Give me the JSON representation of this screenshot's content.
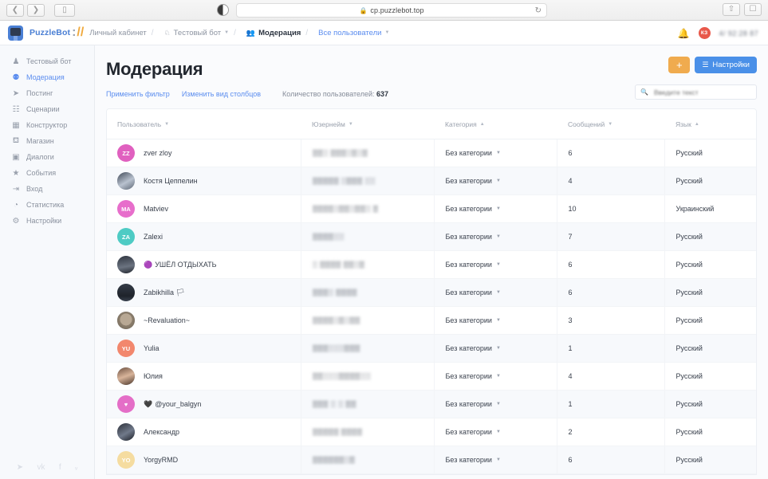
{
  "browser": {
    "back_icon": "chevron-left-icon",
    "forward_icon": "chevron-right-icon",
    "sidebar_toggle_icon": "sidebar-toggle-icon",
    "theme_toggle_icon": "theme-toggle-icon",
    "url": "cp.puzzlebot.top",
    "lock_icon": "lock-icon",
    "reload_icon": "reload-icon",
    "share_icon": "share-icon",
    "tabs_icon": "tabs-icon"
  },
  "header": {
    "logo_icon": "puzzlebot-logo-icon",
    "brand": "PuzzleBot",
    "brand_colon": ":",
    "brand_slash": "//",
    "crumbs": [
      {
        "label": "Личный кабинет",
        "icon": "",
        "caret": "",
        "style": "muted"
      },
      {
        "label": "Тестовый бот",
        "icon": "bot-icon",
        "caret": "▼",
        "style": "muted"
      },
      {
        "label": "Модерация",
        "icon": "users-icon",
        "caret": "",
        "style": "active"
      },
      {
        "label": "Все пользователи",
        "icon": "",
        "caret": "▼",
        "style": "link"
      }
    ],
    "separator": "/",
    "bell_icon": "bell-icon",
    "avatar_initials": "КЗ",
    "avatar_color": "#e8584a",
    "user_name": "4/ 92:28 87"
  },
  "sidebar": {
    "items": [
      {
        "label": "Тестовый бот",
        "icon": "bot-icon",
        "glyph": "♟",
        "active": false
      },
      {
        "label": "Модерация",
        "icon": "users-icon",
        "glyph": "⚉",
        "active": true
      },
      {
        "label": "Постинг",
        "icon": "send-icon",
        "glyph": "➤",
        "active": false
      },
      {
        "label": "Сценарии",
        "icon": "scenario-icon",
        "glyph": "☷",
        "active": false
      },
      {
        "label": "Конструктор",
        "icon": "grid-icon",
        "glyph": "▦",
        "active": false
      },
      {
        "label": "Магазин",
        "icon": "cart-icon",
        "glyph": "Ὥ2",
        "active": false
      },
      {
        "label": "Диалоги",
        "icon": "chat-icon",
        "glyph": "▣",
        "active": false
      },
      {
        "label": "События",
        "icon": "star-icon",
        "glyph": "★",
        "active": false
      },
      {
        "label": "Вход",
        "icon": "login-icon",
        "glyph": "⇥",
        "active": false
      },
      {
        "label": "Статистика",
        "icon": "chart-pie-icon",
        "glyph": "◔",
        "active": false
      },
      {
        "label": "Настройки",
        "icon": "gear-icon",
        "glyph": "⚙",
        "active": false
      }
    ],
    "social": [
      {
        "icon": "telegram-icon",
        "glyph": "➤"
      },
      {
        "icon": "vk-icon",
        "glyph": "vk"
      },
      {
        "icon": "facebook-icon",
        "glyph": "f"
      },
      {
        "icon": "twitter-icon",
        "glyph": "ᵥ"
      }
    ]
  },
  "main": {
    "title": "Модерация",
    "add_label": "+",
    "settings_label": "Настройки",
    "settings_icon": "sliders-icon",
    "apply_filter": "Применить фильтр",
    "change_columns": "Изменить вид столбцов",
    "count_label": "Количество пользователей:",
    "count_value": "637",
    "search_placeholder": "Введите текст",
    "search_icon": "search-icon",
    "accent_blue": "#4a90e8",
    "accent_orange": "#f0ab4e",
    "link_blue": "#5b8def"
  },
  "table": {
    "columns": [
      {
        "label": "Пользователь",
        "sort": "▼"
      },
      {
        "label": "Юзернейм",
        "sort": "▼"
      },
      {
        "label": "Категория",
        "sort": "▲"
      },
      {
        "label": "Сообщений",
        "sort": "▼"
      },
      {
        "label": "Язык",
        "sort": "▲"
      }
    ],
    "rows": [
      {
        "user": "zver zloy",
        "emoji": "",
        "avatar_type": "initials",
        "initials": "ZZ",
        "color": "#e060bf",
        "nickname": "▒▒░ ▒▒▒░▒░▒",
        "category": "Без категории",
        "messages": "6",
        "language": "Русский"
      },
      {
        "user": "Костя Цеппелин",
        "emoji": "",
        "avatar_type": "photo",
        "photo": "p1",
        "initials": "",
        "color": "",
        "nickname": "▒▒▒▒▒ ░▒▒▒ ░░",
        "category": "Без категории",
        "messages": "4",
        "language": "Русский"
      },
      {
        "user": "Matviev",
        "emoji": "",
        "avatar_type": "initials",
        "initials": "MA",
        "color": "#e76ecb",
        "nickname": "▒▒▒▒░▒▒░▒▒░ ▒",
        "category": "Без категории",
        "messages": "10",
        "language": "Украинский"
      },
      {
        "user": "Zalexi",
        "emoji": "",
        "avatar_type": "initials",
        "initials": "ZA",
        "color": "#4ecbc4",
        "nickname": "▒▒▒▒░░",
        "category": "Без категории",
        "messages": "7",
        "language": "Русский"
      },
      {
        "user": "УШЁЛ ОТДЫХАТЬ",
        "emoji": "🟣",
        "avatar_type": "photo",
        "photo": "p2",
        "initials": "",
        "color": "",
        "nickname": "░ ▒▒▒▒ ▒▒░▒",
        "category": "Без категории",
        "messages": "6",
        "language": "Русский"
      },
      {
        "user": "Zabikhilla",
        "emoji": "",
        "emoji_post": "🏳",
        "avatar_type": "photo",
        "photo": "p3",
        "initials": "",
        "color": "",
        "nickname": "▒▒▒░ ▒▒▒▒",
        "category": "Без категории",
        "messages": "6",
        "language": "Русский"
      },
      {
        "user": "~Revaluation~",
        "emoji": "",
        "avatar_type": "photo",
        "photo": "p4",
        "initials": "",
        "color": "",
        "nickname": "▒▒▒▒░▒░▒▒",
        "category": "Без категории",
        "messages": "3",
        "language": "Русский"
      },
      {
        "user": "Yulia",
        "emoji": "",
        "avatar_type": "initials",
        "initials": "YU",
        "color": "#f2876d",
        "nickname": "▒▒▒░░░▒▒▒",
        "category": "Без категории",
        "messages": "1",
        "language": "Русский"
      },
      {
        "user": "Юлия",
        "emoji": "",
        "avatar_type": "photo",
        "photo": "p5",
        "initials": "",
        "color": "",
        "nickname": "▒▒░░░▒▒▒▒░░",
        "category": "Без категории",
        "messages": "4",
        "language": "Русский"
      },
      {
        "user": "@your_balgyn",
        "emoji": "🖤",
        "avatar_type": "initials",
        "initials": "♥",
        "color": "#e46ec7",
        "nickname": "▒▒▒ ░ ░ ▒▒",
        "category": "Без категории",
        "messages": "1",
        "language": "Русский"
      },
      {
        "user": "Александр",
        "emoji": "",
        "avatar_type": "photo",
        "photo": "p6",
        "initials": "",
        "color": "",
        "nickname": "▒▒▒▒▒ ▒▒▒▒",
        "category": "Без категории",
        "messages": "2",
        "language": "Русский"
      },
      {
        "user": "YorgyRMD",
        "emoji": "",
        "avatar_type": "initials",
        "initials": "YO",
        "color": "#f5dca0",
        "nickname": "▒▒▒▒▒▒░▒",
        "category": "Без категории",
        "messages": "6",
        "language": "Русский"
      }
    ]
  }
}
